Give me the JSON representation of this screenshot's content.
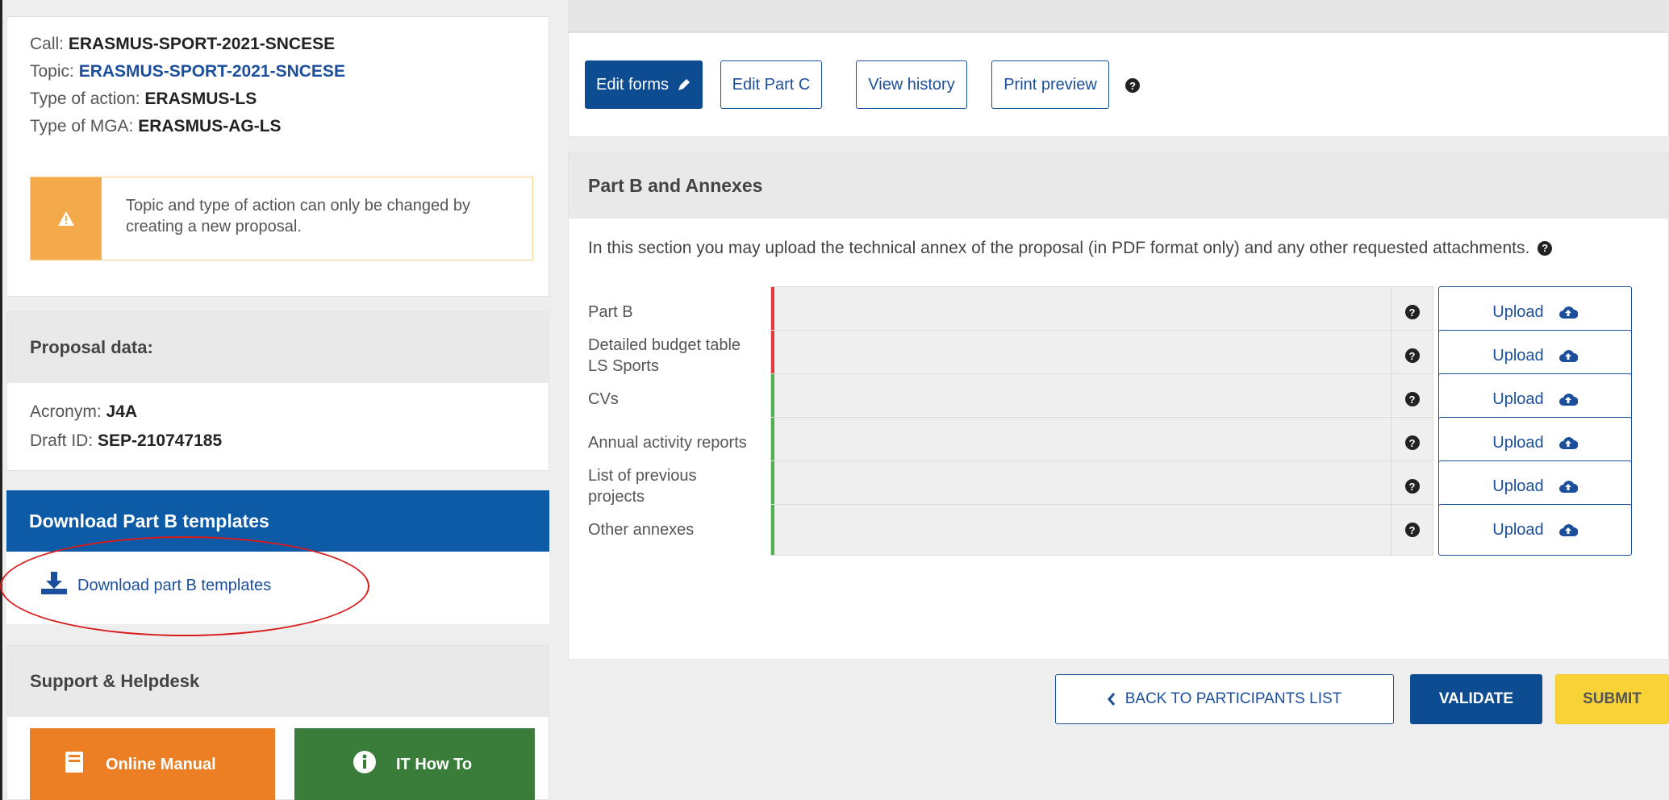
{
  "call": {
    "call_label": "Call: ",
    "call_value": "ERASMUS-SPORT-2021-SNCESE",
    "topic_label": "Topic: ",
    "topic_value": "ERASMUS-SPORT-2021-SNCESE",
    "action_label": "Type of action: ",
    "action_value": "ERASMUS-LS",
    "mga_label": "Type of MGA: ",
    "mga_value": "ERASMUS-AG-LS",
    "warning": "Topic and type of action can only be changed by creating a new proposal."
  },
  "proposal": {
    "heading": "Proposal data:",
    "acronym_label": "Acronym: ",
    "acronym_value": "J4A",
    "draft_label": "Draft ID: ",
    "draft_value": "SEP-210747185"
  },
  "download": {
    "heading": "Download Part B templates",
    "link": "Download part B templates"
  },
  "support": {
    "heading": "Support & Helpdesk",
    "manual": "Online Manual",
    "howto": "IT How To"
  },
  "toolbar": {
    "edit_forms": "Edit forms",
    "edit_part_c": "Edit Part C",
    "view_history": "View history",
    "print_preview": "Print preview"
  },
  "partb": {
    "heading": "Part B and Annexes",
    "description": "In this section you may upload the technical annex of the proposal (in PDF format only) and any other requested attachments.",
    "upload_label": "Upload",
    "rows": [
      {
        "label": "Part B",
        "status_color": "#e03a3a"
      },
      {
        "label": "Detailed budget table LS Sports",
        "status_color": "#e03a3a"
      },
      {
        "label": "CVs",
        "status_color": "#4caf50"
      },
      {
        "label": "Annual activity reports",
        "status_color": "#4caf50"
      },
      {
        "label": "List of previous projects",
        "status_color": "#4caf50"
      },
      {
        "label": "Other annexes",
        "status_color": "#4caf50"
      }
    ]
  },
  "actions": {
    "back": "BACK TO PARTICIPANTS LIST",
    "validate": "VALIDATE",
    "submit": "SUBMIT"
  },
  "colors": {
    "primary": "#0e4c92",
    "download_header": "#0d5aa7",
    "warning": "#f4a94a",
    "manual": "#ec7f23",
    "howto": "#3a7d3a",
    "submit": "#f7d338"
  }
}
